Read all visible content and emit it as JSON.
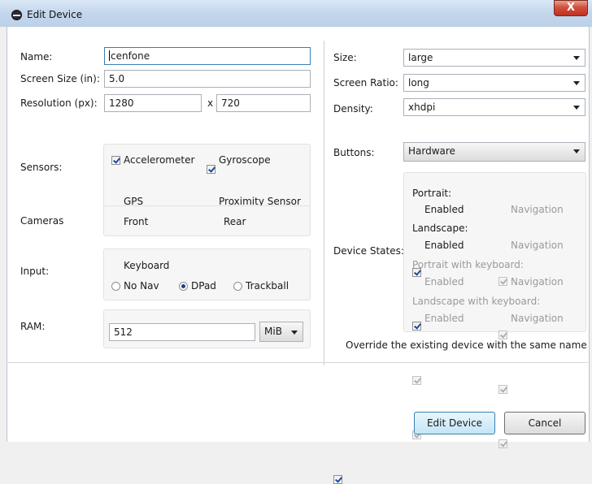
{
  "window": {
    "title": "Edit Device",
    "close_label": "X"
  },
  "left": {
    "name_label": "Name:",
    "name_value": "cenfone",
    "screen_size_label": "Screen Size (in):",
    "screen_size_value": "5.0",
    "resolution_label": "Resolution (px):",
    "resolution_w": "1280",
    "resolution_sep": "x",
    "resolution_h": "720",
    "sensors_label": "Sensors:",
    "sensors": {
      "accelerometer": {
        "label": "Accelerometer",
        "checked": true
      },
      "gyroscope": {
        "label": "Gyroscope",
        "checked": true
      },
      "gps": {
        "label": "GPS",
        "checked": false
      },
      "proximity": {
        "label": "Proximity Sensor",
        "checked": true
      }
    },
    "cameras_label": "Cameras",
    "cameras": {
      "front": {
        "label": "Front",
        "checked": false
      },
      "rear": {
        "label": "Rear",
        "checked": false
      }
    },
    "input_label": "Input:",
    "keyboard": {
      "label": "Keyboard",
      "checked": true
    },
    "nav": {
      "no_nav": "No Nav",
      "dpad": "DPad",
      "trackball": "Trackball",
      "selected": "DPad"
    },
    "ram_label": "RAM:",
    "ram_value": "512",
    "ram_unit": "MiB"
  },
  "right": {
    "size_label": "Size:",
    "size_value": "large",
    "ratio_label": "Screen Ratio:",
    "ratio_value": "long",
    "density_label": "Density:",
    "density_value": "xhdpi",
    "buttons_label": "Buttons:",
    "buttons_value": "Hardware",
    "states_label": "Device States:",
    "portrait": "Portrait:",
    "landscape": "Landscape:",
    "portrait_kb": "Portrait with keyboard:",
    "landscape_kb": "Landscape with keyboard:",
    "enabled": "Enabled",
    "navigation": "Navigation",
    "override_label": "Override the existing device with the same name"
  },
  "footer": {
    "edit_button": "Edit Device",
    "cancel_button": "Cancel"
  }
}
